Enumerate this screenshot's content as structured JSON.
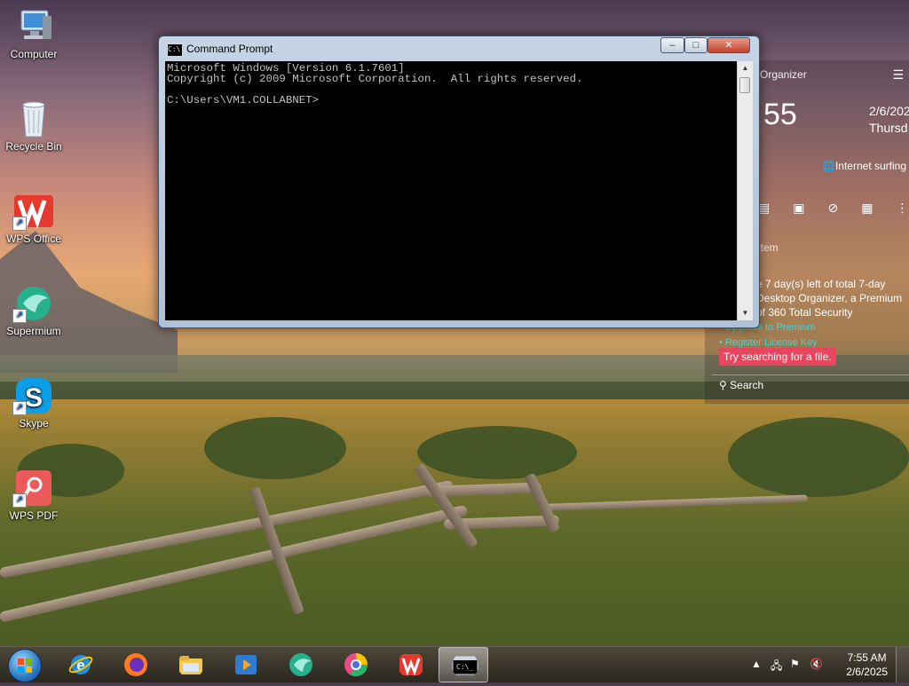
{
  "desktop": {
    "icons": [
      {
        "label": "Computer",
        "icon": "computer-icon"
      },
      {
        "label": "Recycle Bin",
        "icon": "recycle-bin-icon"
      },
      {
        "label": "WPS Office",
        "icon": "wps-office-icon"
      },
      {
        "label": "Supermium",
        "icon": "supermium-icon"
      },
      {
        "label": "Skype",
        "icon": "skype-icon"
      },
      {
        "label": "WPS PDF",
        "icon": "wps-pdf-icon"
      }
    ]
  },
  "organizer": {
    "title": "Organizer",
    "time": "55",
    "date": "2/6/202",
    "day": "Thursd",
    "network": "Internet surfing",
    "item_label": "item",
    "trial_lines": [
      "e 7 day(s) left of total 7-day",
      "Desktop Organizer, a Premium",
      "of 360 Total Security"
    ],
    "upgrade_link": "Upgrade to Premium",
    "register_link": "Register License Key",
    "tip": "Try searching for a file.",
    "search_placeholder": "Search"
  },
  "cmd": {
    "title": "Command Prompt",
    "lines": [
      "Microsoft Windows [Version 6.1.7601]",
      "Copyright (c) 2009 Microsoft Corporation.  All rights reserved.",
      "",
      "C:\\Users\\VM1.COLLABNET>"
    ],
    "buttons": {
      "minimize": "–",
      "maximize": "□",
      "close": "✕"
    }
  },
  "taskbar": {
    "items": [
      {
        "name": "internet-explorer",
        "icon": "internet-explorer-icon"
      },
      {
        "name": "firefox",
        "icon": "firefox-icon"
      },
      {
        "name": "file-explorer",
        "icon": "file-explorer-icon"
      },
      {
        "name": "media-player",
        "icon": "media-player-icon"
      },
      {
        "name": "supermium",
        "icon": "supermium-icon"
      },
      {
        "name": "chrome-style-browser",
        "icon": "browser-icon"
      },
      {
        "name": "wps-office",
        "icon": "wps-office-icon"
      },
      {
        "name": "command-prompt",
        "icon": "cmd-icon",
        "active": true
      }
    ],
    "clock_time": "7:55 AM",
    "clock_date": "2/6/2025"
  },
  "colors": {
    "tip_bg": "#e8455e",
    "link": "#4fd0d0",
    "console_text": "#c0c0c0"
  }
}
